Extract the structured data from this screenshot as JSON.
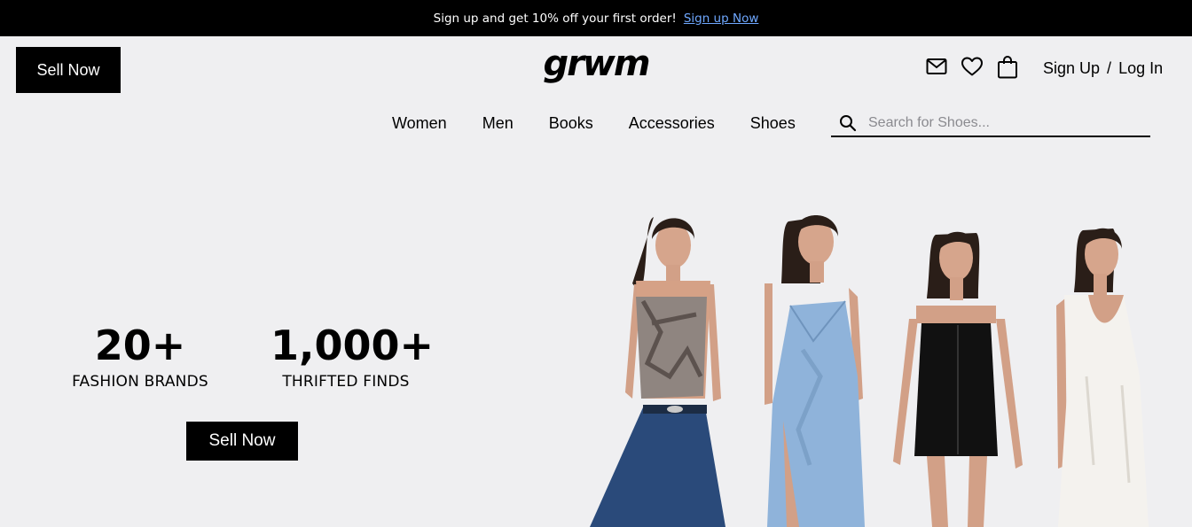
{
  "promo": {
    "text": "Sign up and get 10% off your first order!",
    "link": "Sign up Now"
  },
  "header": {
    "sell_button": "Sell Now",
    "logo_text": "grwm",
    "icons": [
      "mail-icon",
      "heart-icon",
      "shopping-bag-icon"
    ],
    "sign_up": "Sign Up",
    "separator": "/",
    "log_in": "Log In"
  },
  "nav": {
    "items": [
      "Women",
      "Men",
      "Books",
      "Accessories",
      "Shoes"
    ]
  },
  "search": {
    "placeholder": "Search for Shoes..."
  },
  "hero": {
    "stats": [
      {
        "number": "20+",
        "label": "FASHION BRANDS"
      },
      {
        "number": "1,000+",
        "label": "THRIFTED FINDS"
      }
    ],
    "cta": "Sell Now",
    "image_alt": "Four models wearing thrifted outfits"
  },
  "colors": {
    "background": "#efeff1",
    "primary": "#000000",
    "promo_link": "#6fa8ff"
  }
}
